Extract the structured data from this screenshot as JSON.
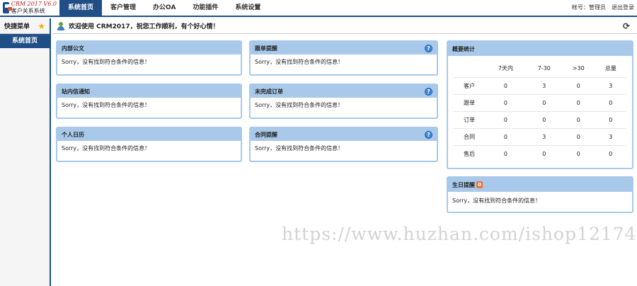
{
  "app": {
    "logo_line1": "CRM 2017 V6.0",
    "logo_line2": "客户关系系统"
  },
  "nav": [
    {
      "label": "系统首页",
      "active": true
    },
    {
      "label": "客户管理",
      "active": false
    },
    {
      "label": "办公OA",
      "active": false
    },
    {
      "label": "功能插件",
      "active": false
    },
    {
      "label": "系统设置",
      "active": false
    }
  ],
  "top_right": {
    "account": "帐号：管理员",
    "logout": "退出登录"
  },
  "sidebar": {
    "title": "快捷菜单",
    "items": [
      "系统首页"
    ]
  },
  "welcome": {
    "text": "欢迎使用 CRM2017，祝您工作顺利，有个好心情！"
  },
  "empty_message": "Sorry，没有找到符合条件的信息！",
  "panels": {
    "doc": {
      "title": "内部公文",
      "body": "Sorry，没有找到符合条件的信息！"
    },
    "followup": {
      "title": "跟单提醒",
      "body": "Sorry，没有找到符合条件的信息！"
    },
    "message": {
      "title": "站内信通知",
      "body": "Sorry，没有找到符合条件的信息！"
    },
    "orders": {
      "title": "未完成订单",
      "body": "Sorry，没有找到符合条件的信息！"
    },
    "calendar": {
      "title": "个人日历",
      "body": "Sorry，没有找到符合条件的信息！"
    },
    "contract": {
      "title": "合同提醒",
      "body": "Sorry，没有找到符合条件的信息！"
    },
    "birthday": {
      "title": "生日提醒",
      "badge": "0",
      "body": "Sorry，没有找到符合条件的信息！"
    }
  },
  "stats": {
    "title": "概要统计",
    "columns": [
      "",
      "7天内",
      "7-30",
      ">30",
      "总量"
    ],
    "rows": [
      [
        "客户",
        "0",
        "3",
        "0",
        "3"
      ],
      [
        "跟单",
        "0",
        "0",
        "0",
        "0"
      ],
      [
        "订单",
        "0",
        "0",
        "0",
        "0"
      ],
      [
        "合同",
        "0",
        "3",
        "0",
        "3"
      ],
      [
        "售后",
        "0",
        "0",
        "0",
        "0"
      ]
    ]
  },
  "watermark": "https://www.huzhan.com/ishop12174",
  "colors": {
    "brand": "#1f4f86",
    "panel_header": "#a9c9ea",
    "badge": "#e8743b"
  }
}
